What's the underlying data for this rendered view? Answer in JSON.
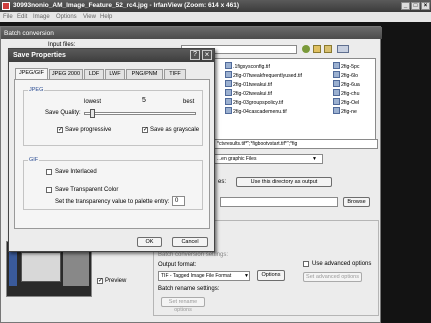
{
  "window": {
    "title": "30993nonio_AM_Image_Feature_52_rc4.jpg - IrfanView (Zoom: 614 x 461)",
    "menu": [
      "File",
      "Edit",
      "Image",
      "Options",
      "View",
      "Help"
    ],
    "controls": {
      "minimize": "_",
      "maximize": "□",
      "close": "×"
    }
  },
  "batch": {
    "title": "Batch conversion",
    "input_files_label": "Input files:",
    "files": [
      ".1figsysconfig.tif",
      "2fig-07tweakfrequentlyused.tif",
      "2fig-01tweakui.tif",
      "2fig-02tweakui.tif",
      "2fig-03groupspolicy.tif",
      "2fig-04cascademenu.tif"
    ],
    "files_right": [
      "2fig-5pc",
      "2fig-6lo",
      "2fig-6ua",
      "2fig-chu",
      "2fig-Oel",
      "2fig-ne"
    ],
    "filter_value": "*ctvresults.tif*\";*figbootvstart.tif*\";*fig",
    "filetype_value": "...en graphic Files",
    "use_dir_label": "Use this directory as output",
    "es_label": "es:",
    "browse_label": "Browse",
    "conversion_settings_label": "Batch conversion settings:",
    "output_format_label": "Output format:",
    "output_format_value": "TIF - Tagged Image File Format",
    "options_label": "Options",
    "use_advanced_label": "Use advanced options",
    "set_advanced_label": "Set advanced options",
    "rename_settings_label": "Batch rename settings:",
    "set_rename_label": "Set rename options",
    "preview_label": "Preview",
    "preview_checked": true
  },
  "save": {
    "title": "Save Properties",
    "help": "?",
    "close": "×",
    "tabs": [
      "JPEG/GIF",
      "JPEG 2000",
      "LDF",
      "LWF",
      "PNG/PNM",
      "TIFF"
    ],
    "active_tab": 0,
    "jpeg_group": "JPEG",
    "lowest_label": "lowest",
    "best_label": "best",
    "quality_value": "5",
    "quality_fraction": 0.05,
    "save_quality_label": "Save Quality:",
    "progressive_label": "Save progressive",
    "progressive_checked": true,
    "grayscale_label": "Save as grayscale",
    "grayscale_checked": true,
    "gif_group": "GIF",
    "interlaced_label": "Save Interlaced",
    "interlaced_checked": false,
    "transparent_label": "Save Transparent Color",
    "transparent_checked": false,
    "palette_label": "Set the transparency value to palette entry:",
    "palette_value": "0",
    "ok_label": "OK",
    "cancel_label": "Cancel"
  }
}
